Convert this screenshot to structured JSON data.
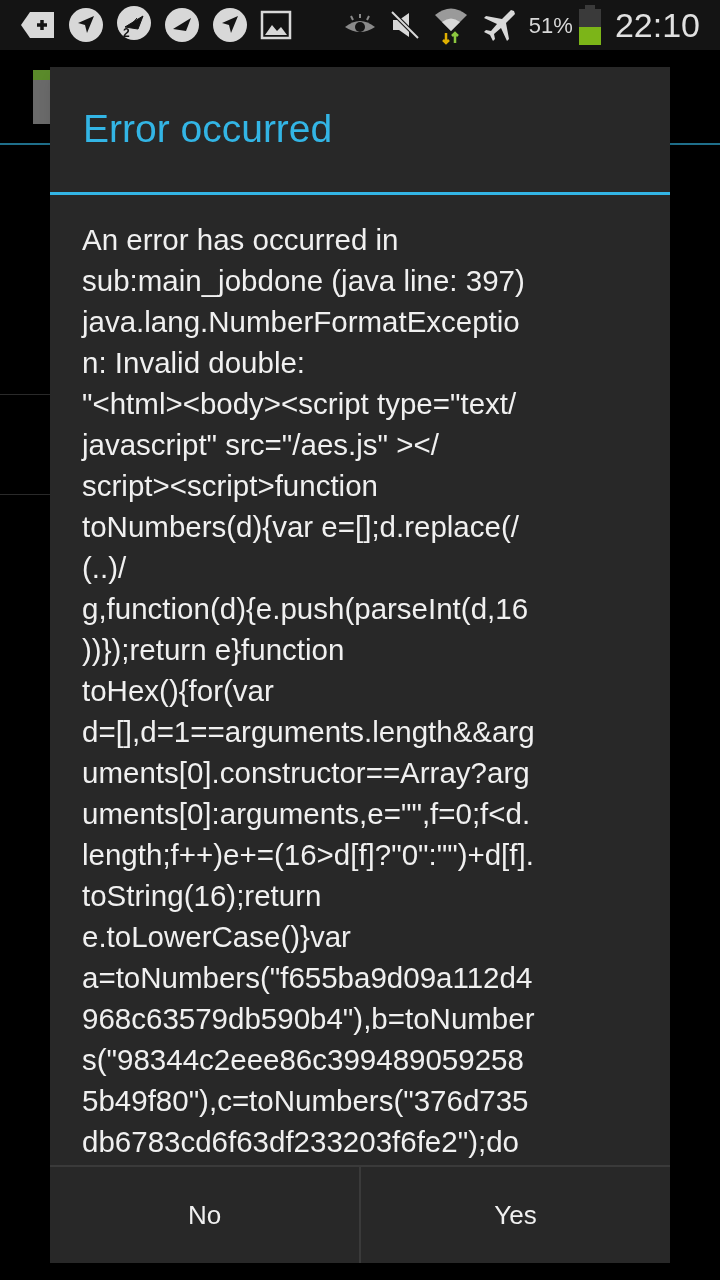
{
  "status_bar": {
    "battery_text": "51%",
    "time": "22:10",
    "notification_badge": "2"
  },
  "dialog": {
    "title": "Error occurred",
    "message_lines": [
      "An error has occurred in",
      "sub:main_jobdone (java line: 397)",
      "java.lang.NumberFormatExceptio",
      "n: Invalid double:",
      "\"<html><body><script type=\"text/",
      "javascript\" src=\"/aes.js\" ></",
      "script><script>function",
      "toNumbers(d){var e=[];d.replace(/",
      "(..)/",
      "g,function(d){e.push(parseInt(d,16",
      "))});return e}function",
      "toHex(){for(var",
      "d=[],d=1==arguments.length&&arg",
      "uments[0].constructor==Array?arg",
      "uments[0]:arguments,e=\"\",f=0;f<d.",
      "length;f++)e+=(16>d[f]?\"0\":\"\")+d[f].",
      "toString(16);return",
      "e.toLowerCase()}var",
      "a=toNumbers(\"f655ba9d09a112d4",
      "968c63579db590b4\"),b=toNumber",
      "s(\"98344c2eee86c399489059258",
      "5b49f80\"),c=toNumbers(\"376d735",
      "db6783cd6f63df233203f6fe2\");do"
    ],
    "buttons": [
      "No",
      "Yes"
    ]
  }
}
